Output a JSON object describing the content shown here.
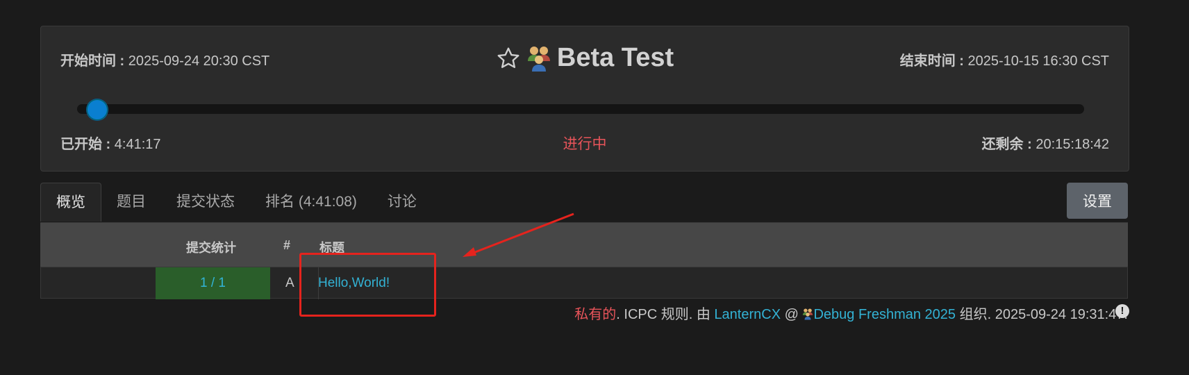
{
  "contest": {
    "title": "Beta Test",
    "start_label": "开始时间 :",
    "start_value": "2025-09-24 20:30 CST",
    "end_label": "结束时间 :",
    "end_value": "2025-10-15 16:30 CST",
    "elapsed_label": "已开始 :",
    "elapsed_value": "4:41:17",
    "status": "进行中",
    "remaining_label": "还剩余 :",
    "remaining_value": "20:15:18:42",
    "progress_fraction": 0.01
  },
  "tabs": [
    {
      "label": "概览",
      "active": true
    },
    {
      "label": "题目",
      "active": false
    },
    {
      "label": "提交状态",
      "active": false
    },
    {
      "label": "排名 (4:41:08)",
      "active": false
    },
    {
      "label": "讨论",
      "active": false
    }
  ],
  "settings_label": "设置",
  "table": {
    "headers": {
      "stats": "提交统计",
      "num": "#",
      "title": "标题"
    },
    "rows": [
      {
        "stats": "1 / 1",
        "letter": "A",
        "title": "Hello,World!"
      }
    ]
  },
  "footer": {
    "private": "私有的",
    "rule": ". ICPC 规则. 由 ",
    "author": "LanternCX",
    "at": " @ ",
    "group": "Debug Freshman 2025",
    "organized": " 组织. 2025-09-24 19:31:47.",
    "info_icon": "!"
  },
  "colors": {
    "accent_link": "#33b2d4",
    "status_red": "#e8545a",
    "accepted_green": "#2a5e2a",
    "annotation_red": "#e5231d"
  },
  "icons": {
    "star": "star-icon",
    "team": "team-icon"
  }
}
